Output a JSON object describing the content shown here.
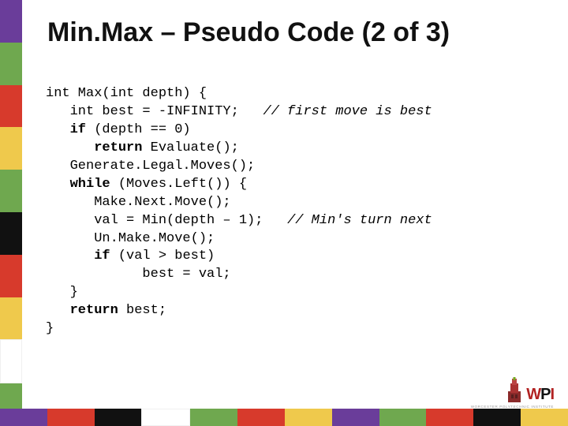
{
  "title": "Min.Max – Pseudo Code (2 of 3)",
  "code": {
    "l1a": "int Max(int depth) {",
    "l2a": "   int best = -INFINITY;   ",
    "l2c": "// first move is best",
    "l3k": "   if",
    "l3a": " (depth == 0)",
    "l4k": "      return",
    "l4a": " Evaluate();",
    "l5a": "   Generate.Legal.Moves();",
    "l6k": "   while",
    "l6a": " (Moves.Left()) {",
    "l7a": "      Make.Next.Move();",
    "l8a": "      val = Min(depth – 1);   ",
    "l8c": "// Min's turn next",
    "l9a": "      Un.Make.Move();",
    "l10k": "      if",
    "l10a": " (val > best)",
    "l11a": "            best = val;",
    "l12a": "   }",
    "l13k": "   return",
    "l13a": " best;",
    "l14a": "}"
  },
  "logo": {
    "text_w": "W",
    "text_p": "P",
    "text_i": "I",
    "sub": "WORCESTER POLYTECHNIC INSTITUTE"
  }
}
